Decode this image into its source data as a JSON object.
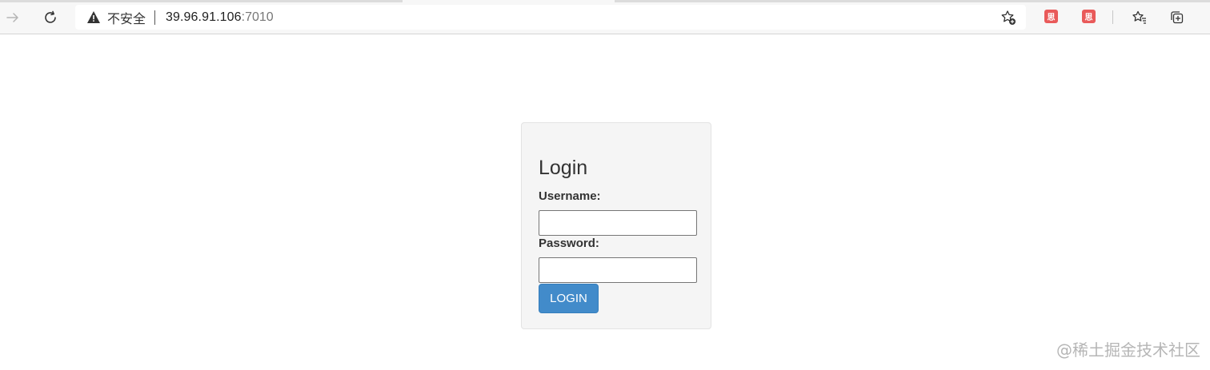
{
  "browser": {
    "address_bar": {
      "security_text": "不安全",
      "url_host": "39.96.91.106",
      "url_port": ":7010"
    },
    "extensions": [
      {
        "icon": "ext-icon-red",
        "label": "思"
      },
      {
        "icon": "ext-icon-red",
        "label": "思"
      }
    ]
  },
  "login": {
    "title": "Login",
    "username_label": "Username:",
    "username_value": "",
    "password_label": "Password:",
    "password_value": "",
    "button_label": "LOGIN"
  },
  "watermark": "@稀土掘金技术社区",
  "colors": {
    "button_bg": "#428bca",
    "panel_bg": "#f5f5f5",
    "ext_icon": "#e95a5a"
  }
}
